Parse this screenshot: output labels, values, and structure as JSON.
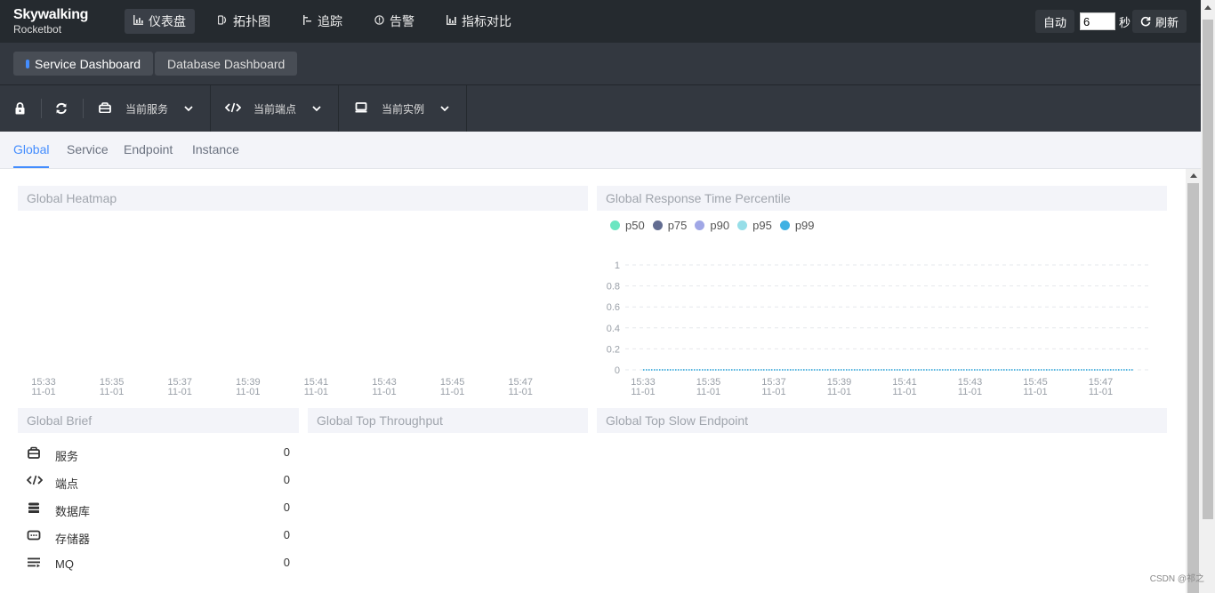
{
  "brand": {
    "line1": "Skywalking",
    "line2": "Rocketbot"
  },
  "nav": [
    {
      "label": "仪表盘",
      "icon": "chart-icon",
      "active": true
    },
    {
      "label": "拓扑图",
      "icon": "topology-icon",
      "active": false
    },
    {
      "label": "追踪",
      "icon": "trace-icon",
      "active": false
    },
    {
      "label": "告警",
      "icon": "alarm-icon",
      "active": false
    },
    {
      "label": "指标对比",
      "icon": "compare-icon",
      "active": false
    }
  ],
  "refresh": {
    "auto_label": "自动",
    "interval_value": "6",
    "unit_label": "秒",
    "refresh_label": "刷新"
  },
  "dashboards": [
    {
      "label": "Service Dashboard",
      "active": true
    },
    {
      "label": "Database Dashboard",
      "active": false
    }
  ],
  "selectors": [
    {
      "label": "当前服务",
      "icon": "service-icon"
    },
    {
      "label": "当前端点",
      "icon": "endpoint-icon"
    },
    {
      "label": "当前实例",
      "icon": "instance-icon"
    }
  ],
  "subtabs": [
    "Global",
    "Service",
    "Endpoint",
    "Instance"
  ],
  "panels": {
    "heatmap": {
      "title": "Global Heatmap"
    },
    "percentile": {
      "title": "Global Response Time Percentile"
    },
    "brief": {
      "title": "Global Brief"
    },
    "throughput": {
      "title": "Global Top Throughput"
    },
    "slow": {
      "title": "Global Top Slow Endpoint"
    }
  },
  "brief_items": [
    {
      "label": "服务",
      "value": "0",
      "icon": "service-icon"
    },
    {
      "label": "端点",
      "value": "0",
      "icon": "endpoint-icon"
    },
    {
      "label": "数据库",
      "value": "0",
      "icon": "database-icon"
    },
    {
      "label": "存储器",
      "value": "0",
      "icon": "storage-icon"
    },
    {
      "label": "MQ",
      "value": "0",
      "icon": "mq-icon"
    }
  ],
  "watermark": "CSDN @祁之",
  "chart_data": [
    {
      "type": "heatmap",
      "title": "Global Heatmap",
      "x_ticks": [
        [
          "15:33",
          "11-01"
        ],
        [
          "15:35",
          "11-01"
        ],
        [
          "15:37",
          "11-01"
        ],
        [
          "15:39",
          "11-01"
        ],
        [
          "15:41",
          "11-01"
        ],
        [
          "15:43",
          "11-01"
        ],
        [
          "15:45",
          "11-01"
        ],
        [
          "15:47",
          "11-01"
        ]
      ],
      "values": []
    },
    {
      "type": "line",
      "title": "Global Response Time Percentile",
      "x_ticks": [
        [
          "15:33",
          "11-01"
        ],
        [
          "15:35",
          "11-01"
        ],
        [
          "15:37",
          "11-01"
        ],
        [
          "15:39",
          "11-01"
        ],
        [
          "15:41",
          "11-01"
        ],
        [
          "15:43",
          "11-01"
        ],
        [
          "15:45",
          "11-01"
        ],
        [
          "15:47",
          "11-01"
        ]
      ],
      "y_ticks": [
        "0",
        "0.2",
        "0.4",
        "0.6",
        "0.8",
        "1"
      ],
      "ylim": [
        0,
        1
      ],
      "grid": true,
      "legend_position": "top-left",
      "series": [
        {
          "name": "p50",
          "color": "#6be6c1",
          "values": [
            0,
            0,
            0,
            0,
            0,
            0,
            0,
            0
          ]
        },
        {
          "name": "p75",
          "color": "#626c91",
          "values": [
            0,
            0,
            0,
            0,
            0,
            0,
            0,
            0
          ]
        },
        {
          "name": "p90",
          "color": "#a0a7e6",
          "values": [
            0,
            0,
            0,
            0,
            0,
            0,
            0,
            0
          ]
        },
        {
          "name": "p95",
          "color": "#96dee8",
          "values": [
            0,
            0,
            0,
            0,
            0,
            0,
            0,
            0
          ]
        },
        {
          "name": "p99",
          "color": "#3fb1e3",
          "values": [
            0,
            0,
            0,
            0,
            0,
            0,
            0,
            0
          ]
        }
      ]
    }
  ]
}
